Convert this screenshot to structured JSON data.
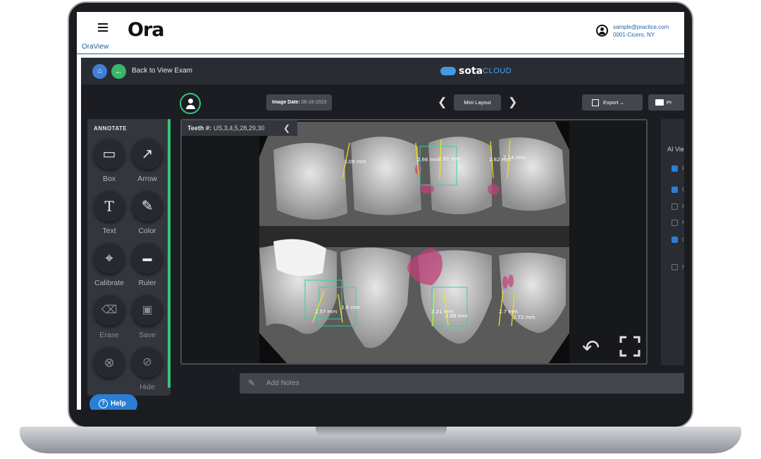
{
  "header": {
    "brand": "Ora",
    "app_name": "OraView",
    "user_email": "sample@practice.com",
    "user_location": "0001-Cicero, NY"
  },
  "viewer_header": {
    "back_label": "Back to View Exam",
    "brand_primary": "sota",
    "brand_secondary": "CLOUD"
  },
  "toolbar": {
    "image_date_label": "Image Date:",
    "image_date_value": "06-16-2023",
    "layout_label": "Mini Layout",
    "export_label": "Export",
    "print_label": "Pr"
  },
  "annotate": {
    "title": "ANNOTATE",
    "tools": [
      {
        "label": "Box"
      },
      {
        "label": "Arrow"
      },
      {
        "label": "Text"
      },
      {
        "label": "Color"
      },
      {
        "label": "Calibrate"
      },
      {
        "label": "Ruler"
      },
      {
        "label": "Erase"
      },
      {
        "label": "Save"
      },
      {
        "label": ""
      },
      {
        "label": "Hide"
      }
    ],
    "help_label": "Help"
  },
  "image": {
    "teeth_label": "Teeth #:",
    "teeth_value": "US,3,4,5,28,29,30",
    "measurements": [
      "3.08 mm",
      "2.66 mm",
      "2.92 mm",
      "2.62 mm",
      "2.14 mm",
      "2.57 mm",
      "2.8 mm",
      "3.21 mm",
      "2.86 mm",
      "2.7 mm",
      "2.72 mm"
    ]
  },
  "ai_panel": {
    "title": "AI View",
    "rows": [
      {
        "label": "P",
        "checked": true
      },
      {
        "label": "Ca",
        "checked": true
      },
      {
        "label": "Pe",
        "checked": false
      },
      {
        "label": "N",
        "checked": false
      },
      {
        "label": "Ca",
        "checked": true
      },
      {
        "label": "N",
        "checked": false
      }
    ]
  },
  "notes": {
    "placeholder": "Add Notes"
  },
  "colors": {
    "accent_blue": "#1f5fa8",
    "accent_green": "#34c77b",
    "lesion": "#c0407a",
    "box": "#2fd3a0",
    "ruler": "#f0e020"
  }
}
